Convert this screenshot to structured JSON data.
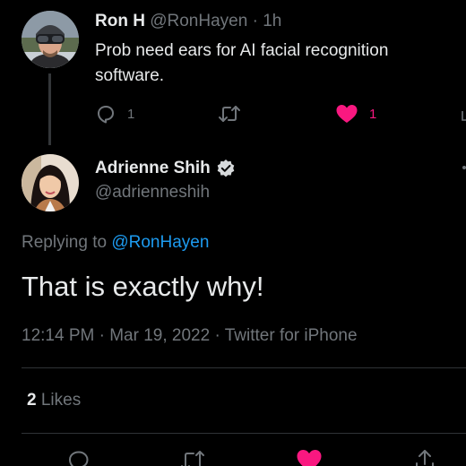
{
  "parent_tweet": {
    "name": "Ron H",
    "handle": "@RonHayen",
    "separator": "·",
    "time": "1h",
    "text": "Prob need ears for AI facial recognition software.",
    "actions": {
      "reply_count": "1",
      "retweet_count": "",
      "like_count": "1",
      "liked": true
    }
  },
  "main_tweet": {
    "name": "Adrienne Shih",
    "verified": true,
    "handle": "@adrienneshih",
    "replying_prefix": "Replying to",
    "replying_to": "@RonHayen",
    "text": "That is exactly why!",
    "meta": "12:14 PM · Mar 19, 2022 · Twitter for iPhone",
    "likes_count": "2",
    "likes_label": "Likes"
  },
  "icons": {
    "reply": "reply-icon",
    "retweet": "retweet-icon",
    "like": "heart-icon",
    "share": "share-icon",
    "verified": "verified-badge-icon"
  },
  "colors": {
    "background": "#000000",
    "text_primary": "#e7e9ea",
    "text_secondary": "#71767b",
    "link": "#1d9bf0",
    "like": "#f91880",
    "divider": "#2f3336"
  }
}
